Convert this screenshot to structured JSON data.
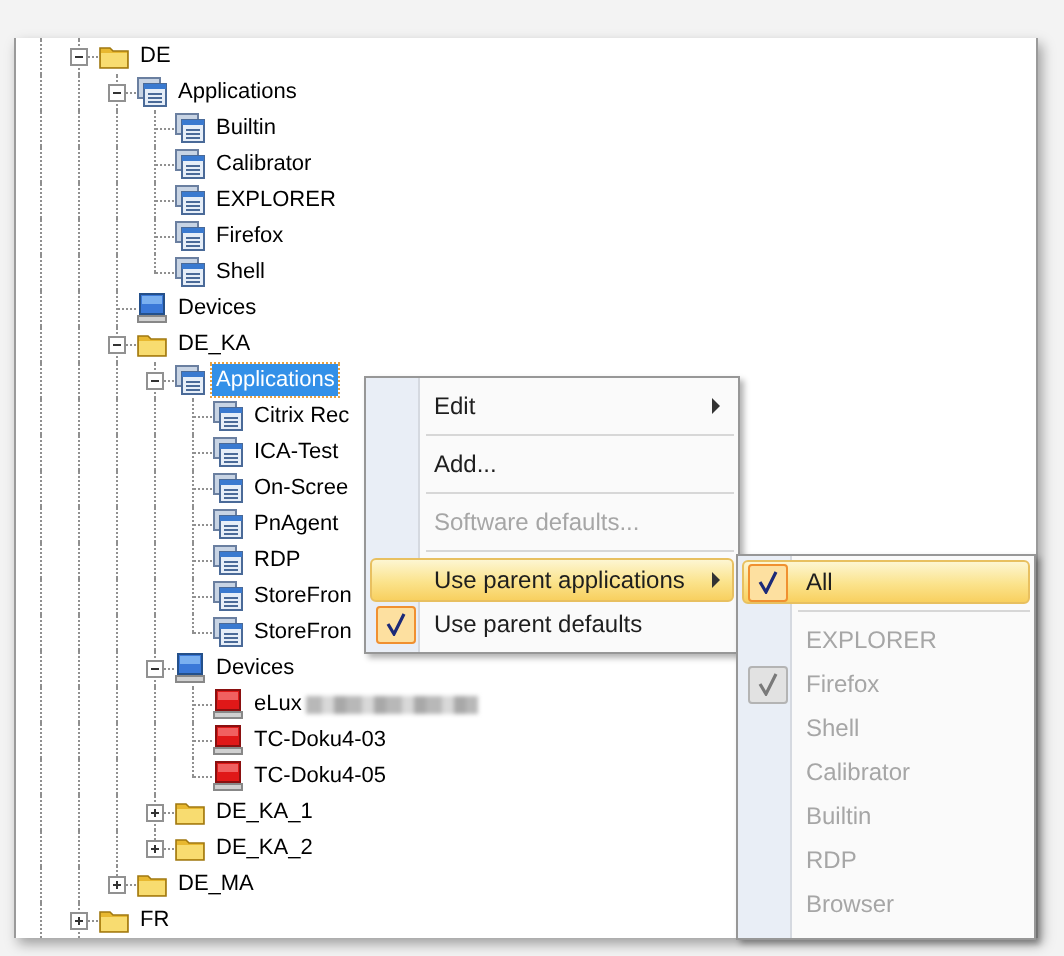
{
  "tree": [
    {
      "label": "DE",
      "kind": "folder",
      "expanded": true,
      "selected": false,
      "children": [
        {
          "label": "Applications",
          "kind": "apps",
          "expanded": true,
          "selected": false,
          "children": [
            {
              "label": "Builtin",
              "kind": "app",
              "selected": false
            },
            {
              "label": "Calibrator",
              "kind": "app",
              "selected": false
            },
            {
              "label": "EXPLORER",
              "kind": "app",
              "selected": false
            },
            {
              "label": "Firefox",
              "kind": "app",
              "selected": false
            },
            {
              "label": "Shell",
              "kind": "app",
              "selected": false
            }
          ]
        },
        {
          "label": "Devices",
          "kind": "devices",
          "selected": false
        },
        {
          "label": "DE_KA",
          "kind": "folder",
          "expanded": true,
          "selected": false,
          "children": [
            {
              "label": "Applications",
              "kind": "apps",
              "expanded": true,
              "selected": true,
              "children": [
                {
                  "label": "Citrix Rec",
                  "kind": "app",
                  "selected": false
                },
                {
                  "label": "ICA-Test",
                  "kind": "app",
                  "selected": false
                },
                {
                  "label": "On-Scree",
                  "kind": "app",
                  "selected": false
                },
                {
                  "label": "PnAgent",
                  "kind": "app",
                  "selected": false
                },
                {
                  "label": "RDP",
                  "kind": "app",
                  "selected": false
                },
                {
                  "label": "StoreFron",
                  "kind": "app",
                  "selected": false
                },
                {
                  "label": "StoreFron",
                  "kind": "app",
                  "selected": false
                }
              ]
            },
            {
              "label": "Devices",
              "kind": "devices",
              "expanded": true,
              "selected": false,
              "children": [
                {
                  "label": "eLux",
                  "kind": "device",
                  "redacted": true,
                  "selected": false
                },
                {
                  "label": "TC-Doku4-03",
                  "kind": "device",
                  "selected": false
                },
                {
                  "label": "TC-Doku4-05",
                  "kind": "device",
                  "selected": false
                }
              ]
            },
            {
              "label": "DE_KA_1",
              "kind": "folder",
              "expanded": false,
              "selected": false
            },
            {
              "label": "DE_KA_2",
              "kind": "folder",
              "expanded": false,
              "selected": false
            }
          ]
        },
        {
          "label": "DE_MA",
          "kind": "folder",
          "expanded": false,
          "selected": false
        }
      ]
    },
    {
      "label": "FR",
      "kind": "folder",
      "expanded": false,
      "selected": false
    }
  ],
  "context_menu": {
    "items": [
      {
        "kind": "item",
        "label": "Edit",
        "has_submenu": true,
        "disabled": false,
        "checked": false,
        "highlighted": false
      },
      {
        "kind": "separator"
      },
      {
        "kind": "item",
        "label": "Add...",
        "has_submenu": false,
        "disabled": false,
        "checked": false,
        "highlighted": false
      },
      {
        "kind": "separator"
      },
      {
        "kind": "item",
        "label": "Software defaults...",
        "has_submenu": false,
        "disabled": true,
        "checked": false,
        "highlighted": false
      },
      {
        "kind": "separator"
      },
      {
        "kind": "item",
        "label": "Use parent applications",
        "has_submenu": true,
        "disabled": false,
        "checked": false,
        "highlighted": true
      },
      {
        "kind": "item",
        "label": "Use parent defaults",
        "has_submenu": false,
        "disabled": false,
        "checked": true,
        "highlighted": false
      }
    ]
  },
  "submenu": {
    "items": [
      {
        "kind": "item",
        "label": "All",
        "has_submenu": false,
        "disabled": false,
        "checked": true,
        "highlighted": true
      },
      {
        "kind": "separator"
      },
      {
        "kind": "item",
        "label": "EXPLORER",
        "has_submenu": false,
        "disabled": true,
        "checked": false,
        "highlighted": false
      },
      {
        "kind": "item",
        "label": "Firefox",
        "has_submenu": false,
        "disabled": true,
        "checked": true,
        "highlighted": false
      },
      {
        "kind": "item",
        "label": "Shell",
        "has_submenu": false,
        "disabled": true,
        "checked": false,
        "highlighted": false
      },
      {
        "kind": "item",
        "label": "Calibrator",
        "has_submenu": false,
        "disabled": true,
        "checked": false,
        "highlighted": false
      },
      {
        "kind": "item",
        "label": "Builtin",
        "has_submenu": false,
        "disabled": true,
        "checked": false,
        "highlighted": false
      },
      {
        "kind": "item",
        "label": "RDP",
        "has_submenu": false,
        "disabled": true,
        "checked": false,
        "highlighted": false
      },
      {
        "kind": "item",
        "label": "Browser",
        "has_submenu": false,
        "disabled": true,
        "checked": false,
        "highlighted": false
      }
    ]
  }
}
